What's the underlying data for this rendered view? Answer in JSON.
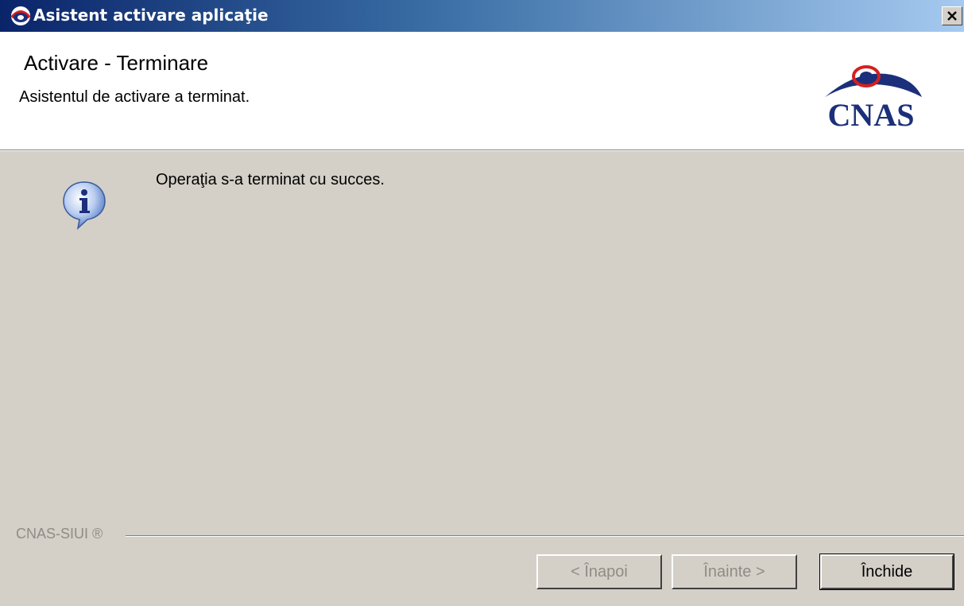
{
  "window": {
    "title": "Asistent activare aplicaţie",
    "close_symbol": "✕"
  },
  "header": {
    "title": "Activare - Terminare",
    "subtitle": "Asistentul de activare a terminat.",
    "logo_text": "CNAS"
  },
  "body": {
    "message": "Operaţia s-a terminat cu succes.",
    "icon": "info-icon"
  },
  "footer": {
    "label": "CNAS-SIUI ®"
  },
  "buttons": {
    "back_label": "< Înapoi",
    "next_label": "Înainte >",
    "close_label": "Închide"
  },
  "colors": {
    "titlebar_start": "#0a246a",
    "titlebar_end": "#a6caf0",
    "dialog_bg": "#d4d0c8",
    "logo_blue": "#1c2f7a",
    "logo_red": "#d42020"
  }
}
